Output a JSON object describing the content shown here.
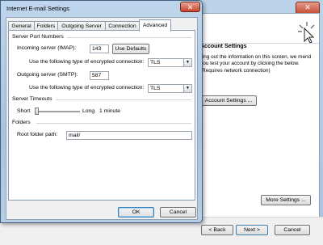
{
  "background_window": {
    "section_title": "Account Settings",
    "description": "lling out the information on this screen, we mend you test your account by clicking the below. (Requires network connection)",
    "test_button_label": "Account Settings ...",
    "more_settings_label": "More Settings ...",
    "back_label": "< Back",
    "next_label": "Next >",
    "cancel_label": "Cancel",
    "close_glyph": "✕"
  },
  "dialog": {
    "title": "Internet E-mail Settings",
    "close_glyph": "✕",
    "tabs": [
      {
        "label": "General"
      },
      {
        "label": "Folders"
      },
      {
        "label": "Outgoing Server"
      },
      {
        "label": "Connection"
      },
      {
        "label": "Advanced",
        "active": true
      }
    ],
    "server_ports": {
      "group_title": "Server Port Numbers",
      "incoming_label": "Incoming server (IMAP):",
      "incoming_value": "143",
      "use_defaults_label": "Use Defaults",
      "incoming_encryption_label": "Use the following type of encrypted connection:",
      "incoming_encryption_value": "TLS",
      "outgoing_label": "Outgoing server (SMTP):",
      "outgoing_value": "587",
      "outgoing_encryption_label": "Use the following type of encrypted connection:",
      "outgoing_encryption_value": "TLS"
    },
    "server_timeouts": {
      "group_title": "Server Timeouts",
      "short_label": "Short",
      "long_label": "Long",
      "value_label": "1 minute",
      "slider_position": 0.0
    },
    "folders": {
      "group_title": "Folders",
      "root_label": "Root folder path:",
      "root_value": "mail/"
    },
    "ok_label": "OK",
    "cancel_label": "Cancel"
  }
}
